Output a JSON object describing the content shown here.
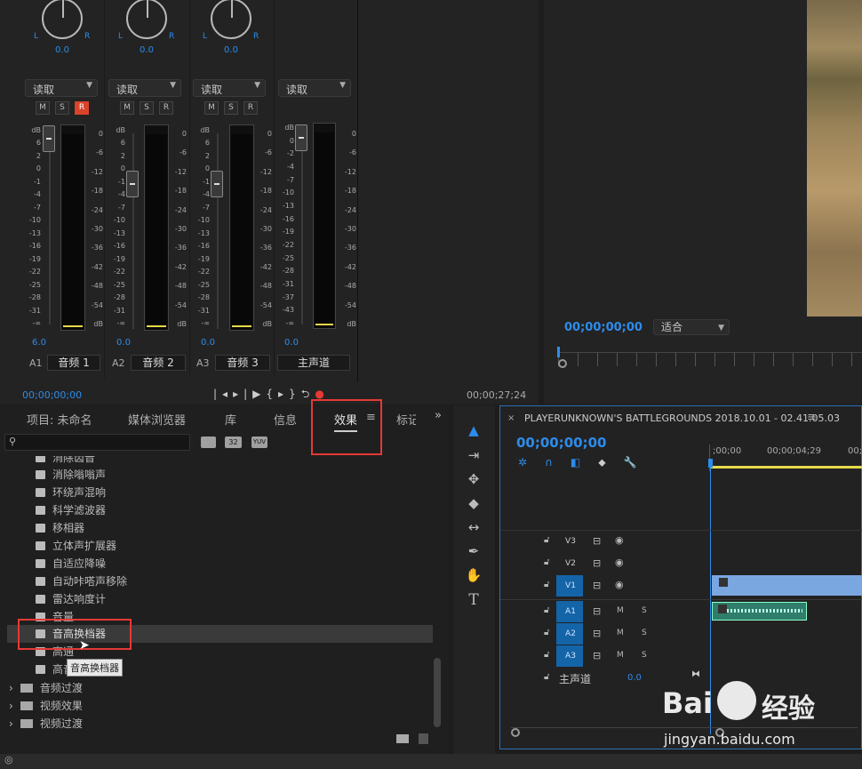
{
  "mixer": {
    "channels": [
      {
        "pan": "0.0",
        "read": "读取",
        "vol": "6.0",
        "id": "A1",
        "name": "音频 1",
        "r_on": true
      },
      {
        "pan": "0.0",
        "read": "读取",
        "vol": "0.0",
        "id": "A2",
        "name": "音频 2",
        "r_on": false
      },
      {
        "pan": "0.0",
        "read": "读取",
        "vol": "0.0",
        "id": "A3",
        "name": "音频 3",
        "r_on": false
      },
      {
        "pan": "",
        "read": "读取",
        "vol": "0.0",
        "id": "",
        "name": "主声道",
        "r_on": false
      }
    ],
    "L": "L",
    "R": "R",
    "M": "M",
    "S": "S",
    "Rb": "R",
    "fader_scale": [
      "dB",
      "6",
      "2",
      "0",
      "-1",
      "-4",
      "-7",
      "-10",
      "-13",
      "-16",
      "-19",
      "-22",
      "-25",
      "-28",
      "-31",
      "-∞"
    ],
    "master_fader_scale": [
      "dB",
      "0",
      "-2",
      "-4",
      "-7",
      "-10",
      "-13",
      "-16",
      "-19",
      "-22",
      "-25",
      "-28",
      "-31",
      "-37",
      "-43",
      "-∞"
    ],
    "meter_scale": [
      "0",
      "-6",
      "-12",
      "-18",
      "-24",
      "-30",
      "-36",
      "-42",
      "-48",
      "-54",
      "dB"
    ],
    "timecode_left": "00;00;00;00",
    "timecode_right": "00;00;27;24"
  },
  "monitor": {
    "timecode": "00;00;00;00",
    "fit": "适合"
  },
  "tabs": [
    "项目: 未命名",
    "媒体浏览器",
    "库",
    "信息",
    "效果",
    "标记"
  ],
  "effects": {
    "search_placeholder": "",
    "badges": [
      "32",
      "YUV"
    ],
    "items": [
      "消除齿音",
      "消除嗡嗡声",
      "环绕声混响",
      "科学滤波器",
      "移相器",
      "立体声扩展器",
      "自适应降噪",
      "自动咔嗒声移除",
      "雷达响度计",
      "音量",
      "音高换档器",
      "高通",
      "高音"
    ],
    "tooltip": "音高换档器",
    "folders": [
      "音频过渡",
      "视频效果",
      "视频过渡"
    ]
  },
  "timeline": {
    "title": "PLAYERUNKNOWN'S BATTLEGROUNDS 2018.10.01 - 02.41.05.03",
    "timecode": "00;00;00;00",
    "ruler": [
      ";00;00",
      "00;00;04;29",
      "00;00"
    ],
    "tracks": [
      "V3",
      "V2",
      "V1",
      "A1",
      "A2",
      "A3"
    ],
    "master": "主声道",
    "master_val": "0.0",
    "M": "M",
    "S": "S"
  },
  "watermark": {
    "line1": "Bai",
    "line2": "经验",
    "url": "jingyan.baidu.com"
  }
}
